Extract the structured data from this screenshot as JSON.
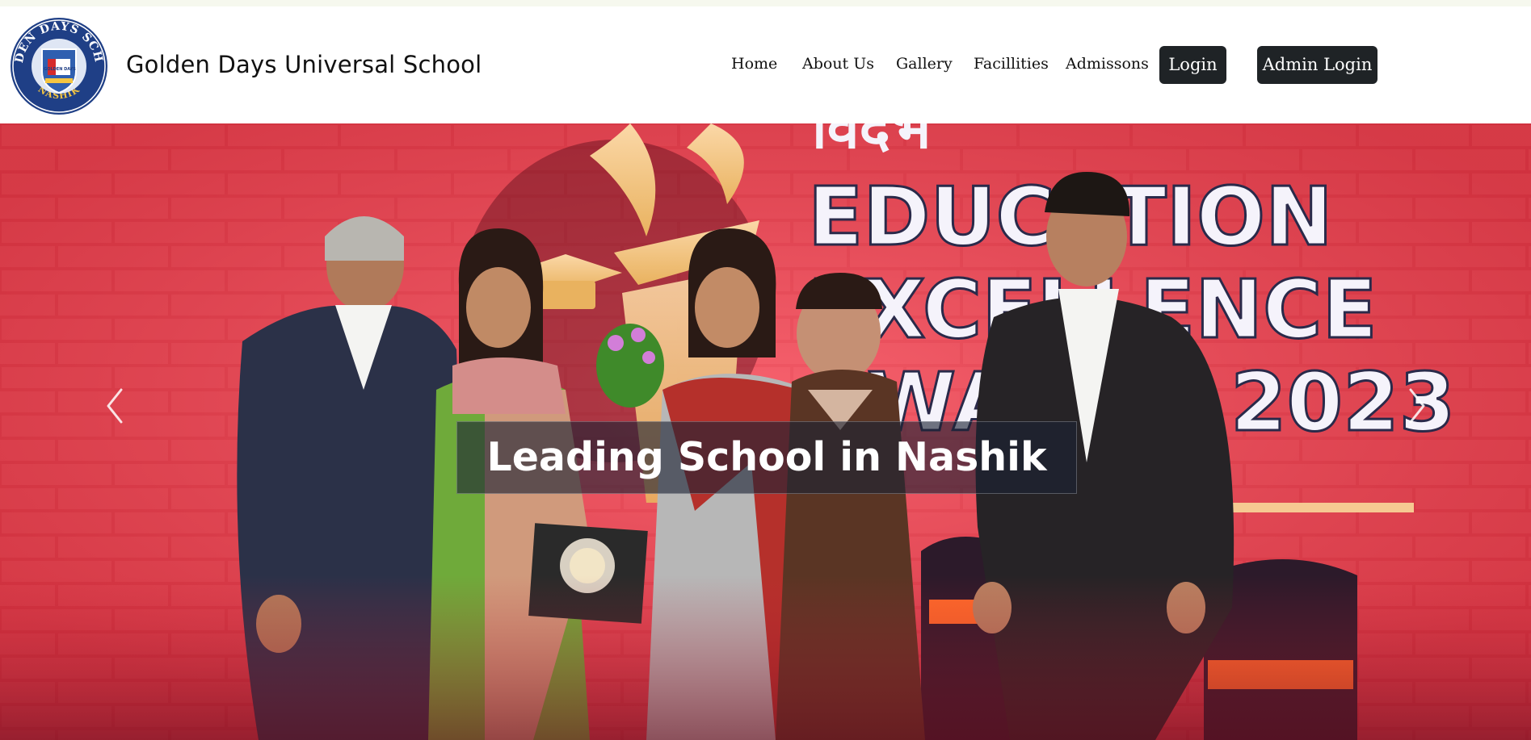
{
  "site": {
    "name": "Golden Days Universal School"
  },
  "logo": {
    "top_text": "GOLDEN DAYS SCHOOL",
    "bottom_text": "NASHIK",
    "crest_text": "GOLDEN DAYS"
  },
  "nav": {
    "links": [
      "Home",
      "About Us",
      "Gallery",
      "Facillities",
      "Admissons"
    ],
    "login_label": "Login",
    "admin_login_label": "Admin Login"
  },
  "hero": {
    "caption": "Leading School in Nashik",
    "banner_line1": "EDUCATION",
    "banner_line2": "EXCELLENCE",
    "banner_line3": "AWARDS 2023"
  },
  "colors": {
    "nav_button_bg": "#1f2326",
    "hero_red": "#e23a47",
    "logo_blue": "#1f3f86"
  }
}
